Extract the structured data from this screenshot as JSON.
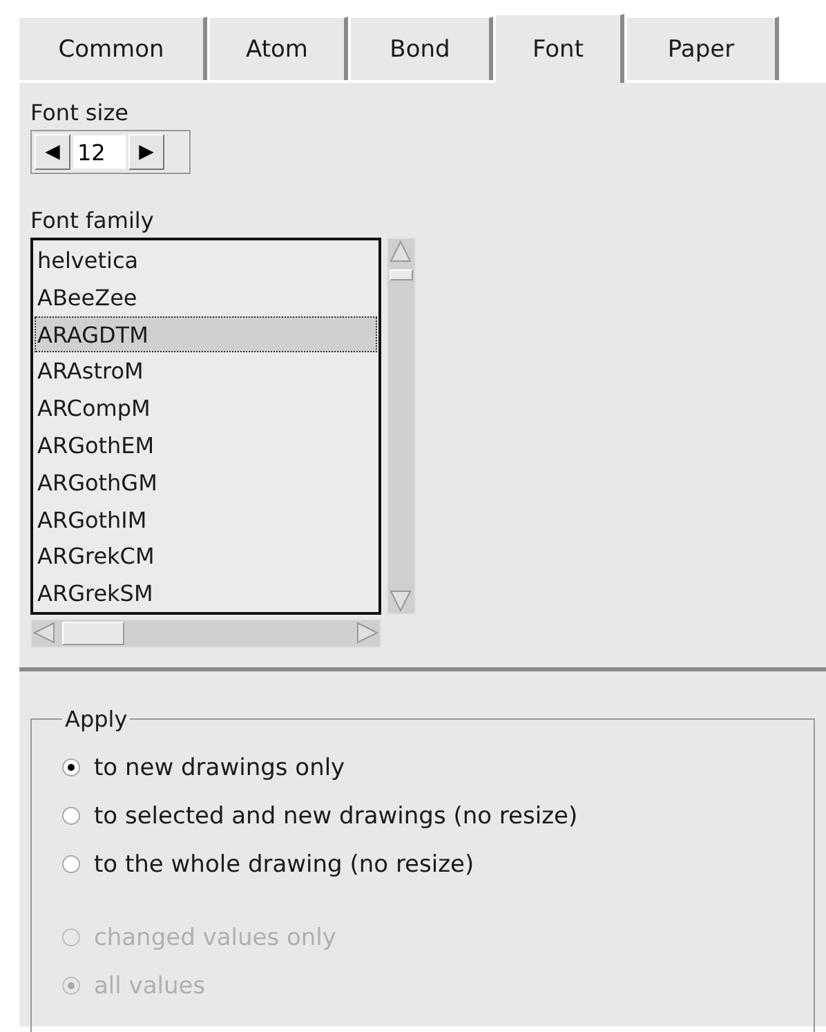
{
  "tabs": [
    {
      "label": "Common",
      "selected": false
    },
    {
      "label": "Atom",
      "selected": false
    },
    {
      "label": "Bond",
      "selected": false
    },
    {
      "label": "Font",
      "selected": true
    },
    {
      "label": "Paper",
      "selected": false
    }
  ],
  "font_size": {
    "label": "Font size",
    "value": "12",
    "decrement": "◀",
    "increment": "▶"
  },
  "font_family": {
    "label": "Font family",
    "items": [
      {
        "label": "helvetica",
        "selected": false
      },
      {
        "label": "ABeeZee",
        "selected": false
      },
      {
        "label": "ARAGDTM",
        "selected": true
      },
      {
        "label": "ARAstroM",
        "selected": false
      },
      {
        "label": "ARCompM",
        "selected": false
      },
      {
        "label": "ARGothEM",
        "selected": false
      },
      {
        "label": "ARGothGM",
        "selected": false
      },
      {
        "label": "ARGothIM",
        "selected": false
      },
      {
        "label": "ARGrekCM",
        "selected": false
      },
      {
        "label": "ARGrekSM",
        "selected": false
      }
    ]
  },
  "apply": {
    "legend": "Apply",
    "groups": [
      {
        "disabled": false,
        "options": [
          {
            "label": "to new drawings only",
            "selected": true
          },
          {
            "label": "to selected and new drawings (no resize)",
            "selected": false
          },
          {
            "label": "to the whole drawing (no resize)",
            "selected": false
          }
        ]
      },
      {
        "disabled": true,
        "options": [
          {
            "label": "changed values only",
            "selected": false
          },
          {
            "label": "all values",
            "selected": true
          }
        ]
      }
    ]
  }
}
